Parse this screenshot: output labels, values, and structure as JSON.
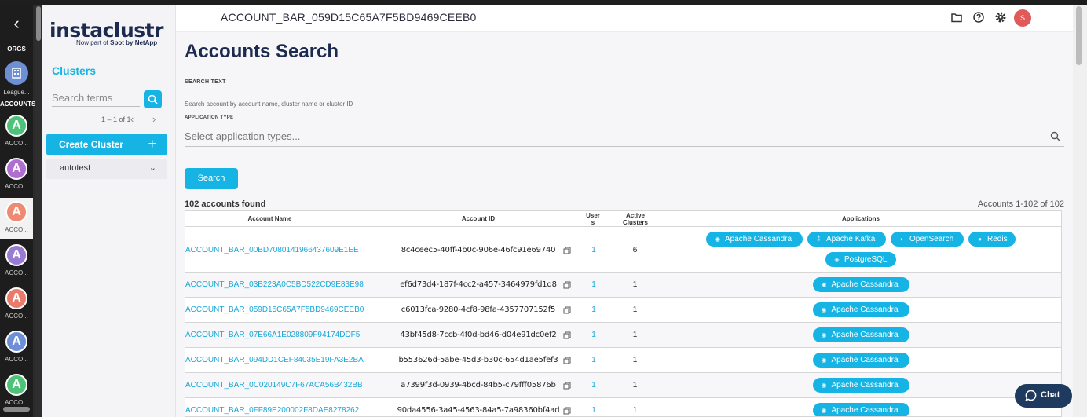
{
  "rail": {
    "orgs_label": "ORGS",
    "org_name": "League...",
    "accounts_label": "ACCOUNTS",
    "accounts": [
      {
        "letter": "A",
        "label": "ACCO...",
        "color": "#4fc27a"
      },
      {
        "letter": "A",
        "label": "ACCO...",
        "color": "#b06ed0"
      },
      {
        "letter": "A",
        "label": "ACCO...",
        "color": "#ee8a74"
      },
      {
        "letter": "A",
        "label": "ACCO...",
        "color": "#9a7bd3"
      },
      {
        "letter": "A",
        "label": "ACCO...",
        "color": "#ea7a6a"
      },
      {
        "letter": "A",
        "label": "ACCO...",
        "color": "#6c8fd8"
      },
      {
        "letter": "A",
        "label": "ACCO...",
        "color": "#4fc27a"
      }
    ]
  },
  "sidebar": {
    "brand": "instaclustr",
    "brand_sub_prefix": "Now part of ",
    "brand_sub_bold": "Spot by NetApp",
    "clusters_title": "Clusters",
    "search_placeholder": "Search terms",
    "pager": "1 – 1 of 1",
    "create_cluster": "Create Cluster",
    "cluster_group": "autotest"
  },
  "header": {
    "account_title": "ACCOUNT_BAR_059D15C65A7F5BD9469CEEB0",
    "avatar_letter": "S"
  },
  "page": {
    "title": "Accounts Search",
    "search_text_label": "SEARCH TEXT",
    "search_text_helper": "Search account by account name, cluster name or cluster ID",
    "application_type_label": "APPLICATION TYPE",
    "application_type_placeholder": "Select application types...",
    "search_button": "Search",
    "found": "102 accounts found",
    "range": "Accounts 1-102 of 102"
  },
  "table": {
    "headers": {
      "name": "Account Name",
      "id": "Account ID",
      "users": "Users",
      "active": "Active Clusters",
      "apps": "Applications"
    },
    "rows": [
      {
        "name": "ACCOUNT_BAR_00BD7080141966437609E1EE",
        "id": "8c4ceec5-40ff-4b0c-906e-46fc91e69740",
        "users": "1",
        "active": "6",
        "apps": [
          "Apache Cassandra",
          "Apache Kafka",
          "OpenSearch",
          "Redis",
          "PostgreSQL"
        ]
      },
      {
        "name": "ACCOUNT_BAR_03B223A0C5BD522CD9E83E98",
        "id": "ef6d73d4-187f-4cc2-a457-3464979fd1d8",
        "users": "1",
        "active": "1",
        "apps": [
          "Apache Cassandra"
        ]
      },
      {
        "name": "ACCOUNT_BAR_059D15C65A7F5BD9469CEEB0",
        "id": "c6013fca-9280-4cf8-98fa-4357707152f5",
        "users": "1",
        "active": "1",
        "apps": [
          "Apache Cassandra"
        ]
      },
      {
        "name": "ACCOUNT_BAR_07E66A1E028809F94174DDF5",
        "id": "43bf45d8-7ccb-4f0d-bd46-d04e91dc0ef2",
        "users": "1",
        "active": "1",
        "apps": [
          "Apache Cassandra"
        ]
      },
      {
        "name": "ACCOUNT_BAR_094DD1CEF84035E19FA3E2BA",
        "id": "b553626d-5abe-45d3-b30c-654d1ae5fef3",
        "users": "1",
        "active": "1",
        "apps": [
          "Apache Cassandra"
        ]
      },
      {
        "name": "ACCOUNT_BAR_0C020149C7F67ACA56B432BB",
        "id": "a7399f3d-0939-4bcd-84b5-c79fff05876b",
        "users": "1",
        "active": "1",
        "apps": [
          "Apache Cassandra"
        ]
      },
      {
        "name": "ACCOUNT_BAR_0FF89E200002F8DAE8278262",
        "id": "90da4556-3a45-4563-84a5-7a98360bf4ad",
        "users": "1",
        "active": "1",
        "apps": [
          "Apache Cassandra"
        ]
      }
    ]
  },
  "chat_label": "Chat",
  "colors": {
    "accent": "#16b4e5",
    "navy": "#1c2a4f"
  }
}
